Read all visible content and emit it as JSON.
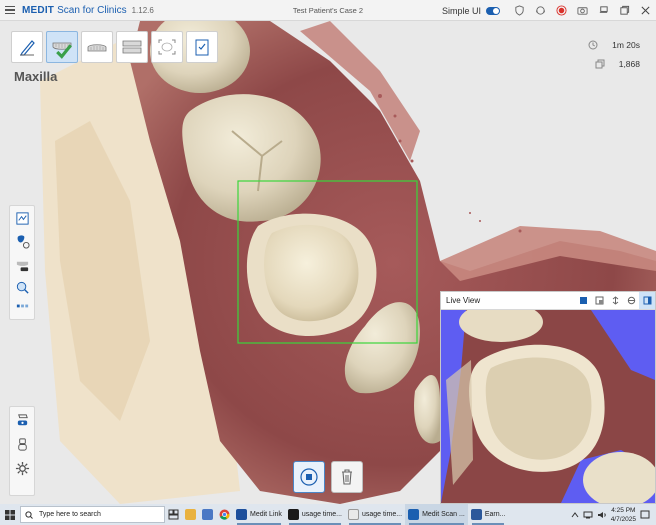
{
  "app": {
    "brand": "MEDIT",
    "product": "Scan for Clinics",
    "version": "1.12.6",
    "case_title": "Test Patient's Case 2",
    "simple_ui_label": "Simple UI",
    "simple_ui_on": true
  },
  "stats": {
    "time": "1m 20s",
    "count": "1,868"
  },
  "arch_label": "Maxilla",
  "live_view": {
    "title": "Live View"
  },
  "taskbar": {
    "search_placeholder": "Type here to search",
    "apps": [
      {
        "label": "Medit Link",
        "color": "#1d4f9c"
      },
      {
        "label": "usage time...",
        "color": "#1a1a1a"
      },
      {
        "label": "usage time...",
        "color": "#e9e9e9"
      },
      {
        "label": "Medit Scan ...",
        "color": "#1b5fb0"
      },
      {
        "label": "Earn...",
        "color": "#2b579a"
      }
    ],
    "time": "4:25 PM",
    "date": "4/7/2025"
  },
  "colors": {
    "accent": "#1b5fb0",
    "scan_box": "#3bd63b",
    "record": "#d9312b"
  }
}
